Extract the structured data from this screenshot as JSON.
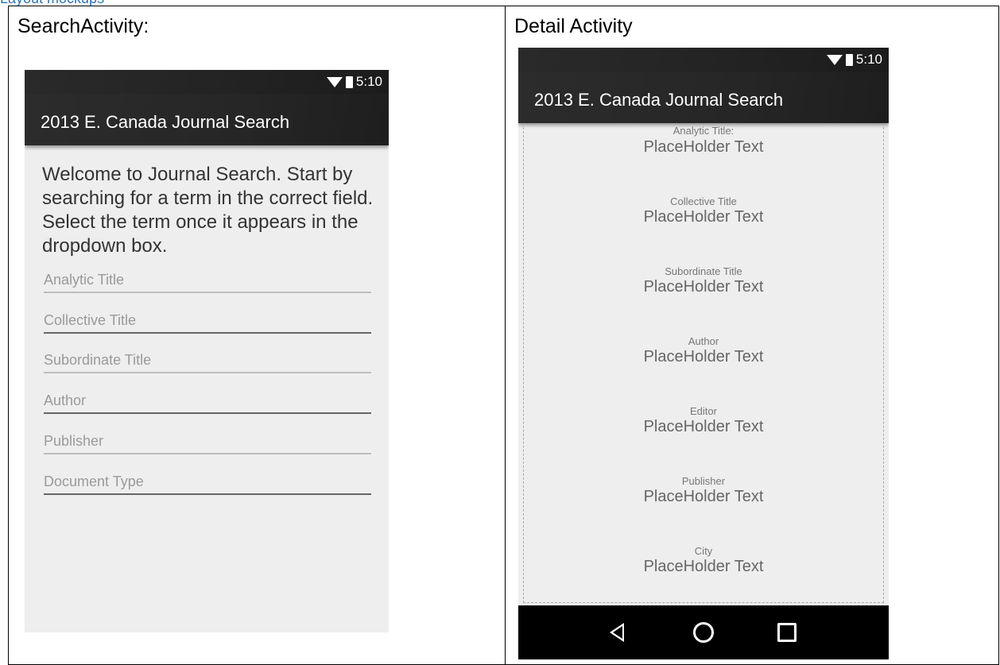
{
  "doc": {
    "clip_text": "Layout mockups",
    "left_caption": "SearchActivity:",
    "right_caption": "Detail Activity"
  },
  "status": {
    "time": "5:10"
  },
  "app": {
    "title": "2013 E. Canada Journal Search"
  },
  "search": {
    "welcome": "Welcome to Journal Search. Start by searching for a term in the correct field. Select the term once it appears in the dropdown box.",
    "fields": [
      {
        "placeholder": "Analytic Title"
      },
      {
        "placeholder": "Collective Title"
      },
      {
        "placeholder": "Subordinate Title"
      },
      {
        "placeholder": "Author"
      },
      {
        "placeholder": "Publisher"
      },
      {
        "placeholder": "Document Type"
      }
    ]
  },
  "detail": {
    "items": [
      {
        "label": "Analytic Title:",
        "value": "PlaceHolder Text"
      },
      {
        "label": "Collective Title",
        "value": "PlaceHolder Text"
      },
      {
        "label": "Subordinate Title",
        "value": "PlaceHolder Text"
      },
      {
        "label": "Author",
        "value": "PlaceHolder Text"
      },
      {
        "label": "Editor",
        "value": "PlaceHolder Text"
      },
      {
        "label": "Publisher",
        "value": "PlaceHolder Text"
      },
      {
        "label": "City",
        "value": "PlaceHolder Text"
      }
    ]
  },
  "icons": {
    "back": "back-triangle-icon",
    "home": "home-circle-icon",
    "recents": "recents-square-icon",
    "wifi": "wifi-icon",
    "battery": "battery-icon"
  }
}
